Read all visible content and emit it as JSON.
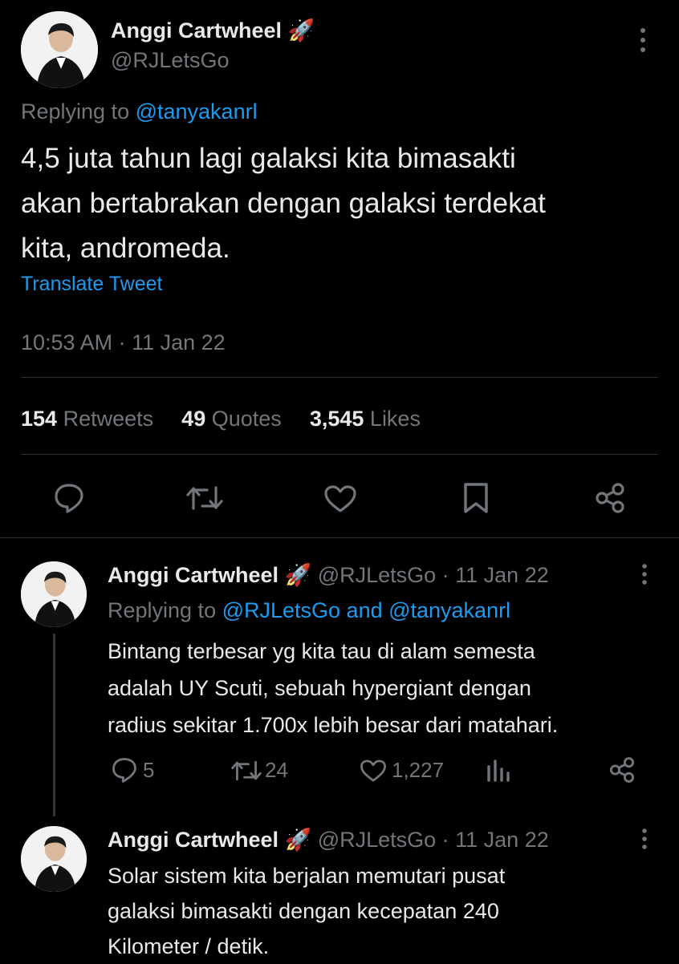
{
  "main_tweet": {
    "author_name": "Anggi Cartwheel",
    "name_emoji": "🚀",
    "handle": "@RJLetsGo",
    "replying_prefix": "Replying to ",
    "replying_to": "@tanyakanrl",
    "text_line1": "4,5 juta tahun lagi galaksi kita bimasakti",
    "text_line2": "akan bertabrakan dengan galaksi terdekat",
    "text_line3": "kita, andromeda.",
    "translate": "Translate Tweet",
    "timestamp": "10:53 AM · 11 Jan 22",
    "stats": {
      "retweets_count": "154",
      "retweets_label": "Retweets",
      "quotes_count": "49",
      "quotes_label": "Quotes",
      "likes_count": "3,545",
      "likes_label": "Likes"
    },
    "actions": [
      "reply-icon",
      "retweet-icon",
      "like-icon",
      "bookmark-icon",
      "share-icon"
    ]
  },
  "reply1": {
    "author_name": "Anggi Cartwheel",
    "name_emoji": "🚀",
    "handle_time": "@RJLetsGo · 11 Jan 22",
    "replying_prefix": "Replying to ",
    "replying_to": "@RJLetsGo and @tanyakanrl",
    "text_line1": "Bintang terbesar yg kita tau di alam semesta",
    "text_line2": "adalah UY Scuti, sebuah hypergiant dengan",
    "text_line3": "radius sekitar 1.700x lebih besar dari matahari.",
    "reply_count": "5",
    "retweet_count": "24",
    "like_count": "1,227"
  },
  "reply2": {
    "author_name": "Anggi Cartwheel",
    "name_emoji": "🚀",
    "handle_time": "@RJLetsGo · 11 Jan 22",
    "text_line1": "Solar sistem kita berjalan memutari pusat",
    "text_line2": "galaksi bimasakti dengan kecepatan 240",
    "text_line3": "Kilometer / detik."
  },
  "colors": {
    "background": "#000000",
    "text": "#e7e9ea",
    "muted": "#71767b",
    "link": "#1d9bf0",
    "divider": "#2f3336"
  }
}
